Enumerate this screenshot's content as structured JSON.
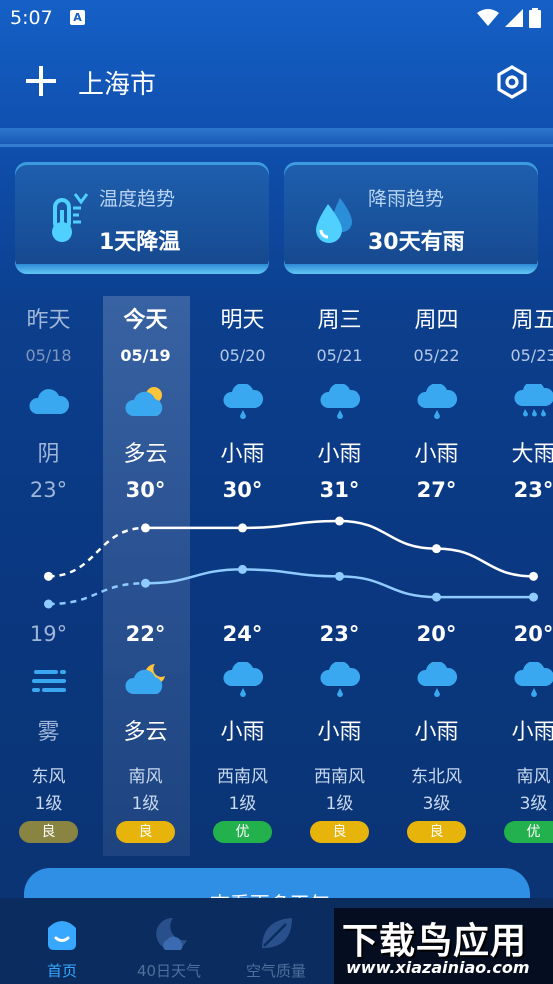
{
  "status_bar": {
    "time": "5:07",
    "notif_letter": "A"
  },
  "header": {
    "city": "上海市"
  },
  "cards": [
    {
      "title": "温度趋势",
      "value": "1天降温",
      "icon": "thermometer-icon"
    },
    {
      "title": "降雨趋势",
      "value": "30天有雨",
      "icon": "rain-drops-icon"
    }
  ],
  "forecast": [
    {
      "day": "昨天",
      "date": "05/18",
      "cond_day": "阴",
      "high": "23°",
      "low": "19°",
      "icon_day": "overcast-icon",
      "icon_night": "fog-icon",
      "cond_night": "雾",
      "wind_dir": "东风",
      "wind_level": "1级",
      "aqi": "良",
      "aqi_color": "#8a8443"
    },
    {
      "day": "今天",
      "date": "05/19",
      "cond_day": "多云",
      "high": "30°",
      "low": "22°",
      "icon_day": "partly-cloudy-day-icon",
      "icon_night": "partly-cloudy-night-icon",
      "cond_night": "多云",
      "wind_dir": "南风",
      "wind_level": "1级",
      "aqi": "良",
      "aqi_color": "#e7b40c"
    },
    {
      "day": "明天",
      "date": "05/20",
      "cond_day": "小雨",
      "high": "30°",
      "low": "24°",
      "icon_day": "light-rain-icon",
      "icon_night": "light-rain-icon",
      "cond_night": "小雨",
      "wind_dir": "西南风",
      "wind_level": "1级",
      "aqi": "优",
      "aqi_color": "#22b14c"
    },
    {
      "day": "周三",
      "date": "05/21",
      "cond_day": "小雨",
      "high": "31°",
      "low": "23°",
      "icon_day": "light-rain-icon",
      "icon_night": "light-rain-icon",
      "cond_night": "小雨",
      "wind_dir": "西南风",
      "wind_level": "1级",
      "aqi": "良",
      "aqi_color": "#e7b40c"
    },
    {
      "day": "周四",
      "date": "05/22",
      "cond_day": "小雨",
      "high": "27°",
      "low": "20°",
      "icon_day": "light-rain-icon",
      "icon_night": "light-rain-icon",
      "cond_night": "小雨",
      "wind_dir": "东北风",
      "wind_level": "3级",
      "aqi": "良",
      "aqi_color": "#e7b40c"
    },
    {
      "day": "周五",
      "date": "05/23",
      "cond_day": "大雨",
      "high": "23°",
      "low": "20°",
      "icon_day": "heavy-rain-icon",
      "icon_night": "light-rain-icon",
      "cond_night": "小雨",
      "wind_dir": "南风",
      "wind_level": "3级",
      "aqi": "优",
      "aqi_color": "#22b14c"
    }
  ],
  "chart_data": {
    "type": "line",
    "categories": [
      "05/18",
      "05/19",
      "05/20",
      "05/21",
      "05/22",
      "05/23"
    ],
    "series": [
      {
        "name": "",
        "values": [
          23,
          30,
          30,
          31,
          27,
          23
        ]
      },
      {
        "name": "",
        "values": [
          19,
          22,
          24,
          23,
          20,
          20
        ]
      }
    ],
    "colors": {
      "high": "#ffffff",
      "low": "#8fcbff"
    }
  },
  "more_button": {
    "label": "查看更多天气 ›"
  },
  "nav": [
    {
      "label": "首页",
      "icon": "home-icon",
      "active": true
    },
    {
      "label": "40日天气",
      "icon": "moon-cloud-icon",
      "active": false
    },
    {
      "label": "空气质量",
      "icon": "leaf-icon",
      "active": false
    }
  ],
  "watermark": {
    "big": "下载鸟应用",
    "small": "www.xiazainiao.com"
  }
}
